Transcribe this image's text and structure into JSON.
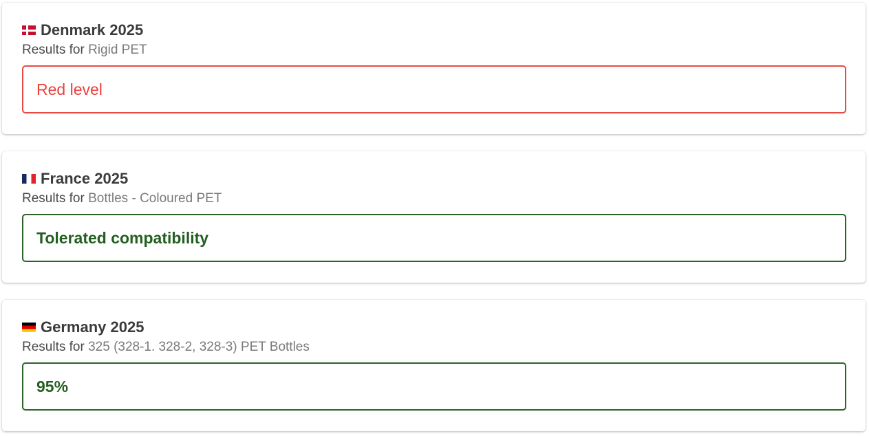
{
  "cards": [
    {
      "country": "Denmark 2025",
      "flag_icon": "denmark-flag-icon",
      "results_prefix": "Results for ",
      "category": "Rigid PET",
      "result": "Red level",
      "result_color": "#e8423c"
    },
    {
      "country": "France 2025",
      "flag_icon": "france-flag-icon",
      "results_prefix": "Results for ",
      "category": "Bottles - Coloured PET",
      "result": "Tolerated compatibility",
      "result_color": "#235f20"
    },
    {
      "country": "Germany 2025",
      "flag_icon": "germany-flag-icon",
      "results_prefix": "Results for ",
      "category": "325 (328-1. 328-2, 328-3) PET Bottles",
      "result": "95%",
      "result_color": "#235f20"
    }
  ]
}
